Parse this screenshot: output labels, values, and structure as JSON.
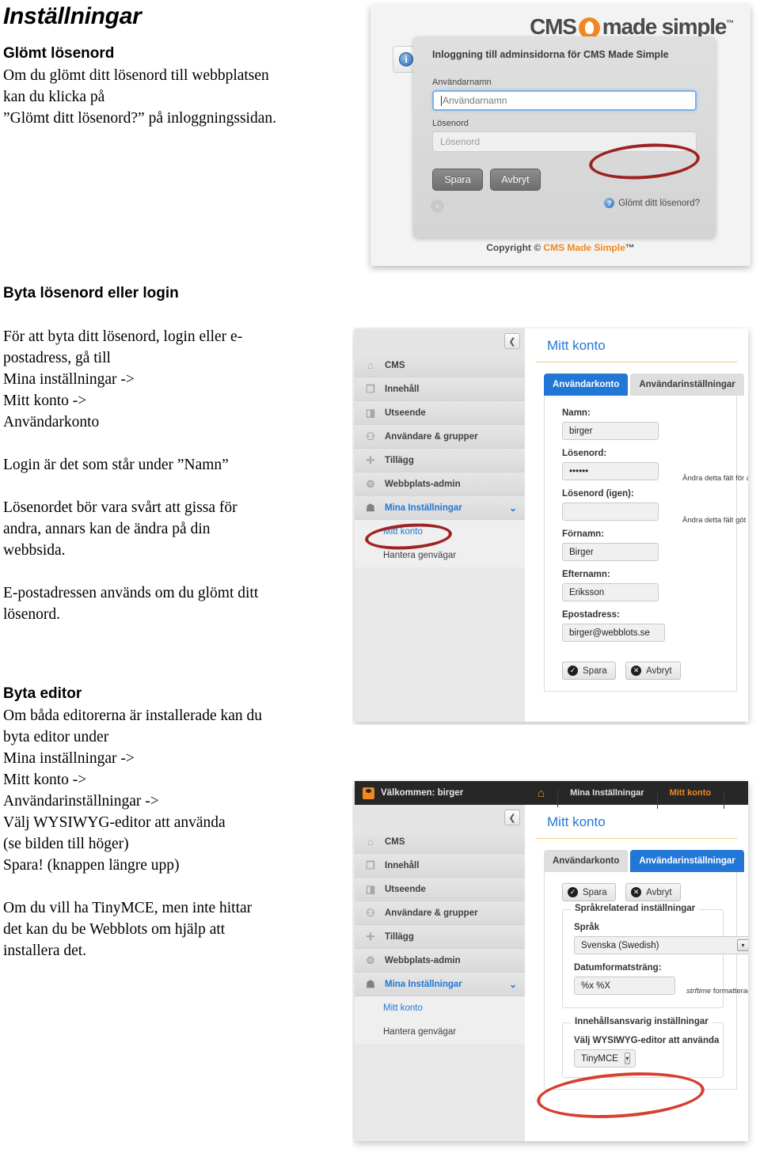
{
  "document": {
    "title": "Inställningar",
    "sections": [
      {
        "heading": "Glömt lösenord",
        "lines": [
          "Om du glömt ditt lösenord till webbplatsen",
          "kan du klicka på",
          "”Glömt ditt lösenord?” på inloggningssidan."
        ]
      },
      {
        "heading": "Byta lösenord eller login",
        "para1": [
          "För att byta ditt lösenord, login eller e-",
          "postadress, gå till",
          "Mina inställningar ->",
          "Mitt konto ->",
          "Användarkonto"
        ],
        "para2": [
          "Login är det som står under ”Namn”"
        ],
        "para3": [
          "Lösenordet bör vara svårt att gissa för",
          "andra, annars kan de ändra på din",
          "webbsida."
        ],
        "para4": [
          "E-postadressen används om du glömt ditt",
          "lösenord."
        ]
      },
      {
        "heading": "Byta editor",
        "para1": [
          "Om båda editorerna är installerade kan du",
          "byta editor under",
          "Mina inställningar ->",
          "Mitt konto ->",
          "Användarinställningar ->",
          "Välj WYSIWYG-editor att använda",
          "(se bilden till höger)",
          "Spara! (knappen längre upp)"
        ],
        "para2": [
          "Om du vill ha TinyMCE, men inte hittar",
          "det kan du be Webblots om hjälp att",
          "installera det."
        ]
      }
    ]
  },
  "screenshot_login": {
    "logo": {
      "part1": "CMS",
      "part2": "made simple",
      "tm": "™"
    },
    "dialog_title": "Inloggning till adminsidorna för CMS Made Simple",
    "username_label": "Användarnamn",
    "username_placeholder": "Användarnamn",
    "password_label": "Lösenord",
    "password_placeholder": "Lösenord",
    "save_button": "Spara",
    "cancel_button": "Avbryt",
    "forgot_link": "Glömt ditt lösenord?",
    "copyright_prefix": "Copyright © ",
    "copyright_brand": "CMS Made Simple",
    "copyright_tm": "™",
    "info_glyph": "i",
    "back_glyph": "‹",
    "question_glyph": "?"
  },
  "screenshot_account": {
    "sidebar": [
      {
        "label": "CMS",
        "icon": "home-icon",
        "glyph": "⌂"
      },
      {
        "label": "Innehåll",
        "icon": "document-icon",
        "glyph": "❐"
      },
      {
        "label": "Utseende",
        "icon": "palette-icon",
        "glyph": "◨"
      },
      {
        "label": "Användare & grupper",
        "icon": "users-icon",
        "glyph": "⚇"
      },
      {
        "label": "Tillägg",
        "icon": "puzzle-icon",
        "glyph": "✛"
      },
      {
        "label": "Webbplats-admin",
        "icon": "gear-icon",
        "glyph": "⚙"
      },
      {
        "label": "Mina Inställningar",
        "icon": "person-icon",
        "glyph": "☗"
      }
    ],
    "sub_items": [
      "Mitt konto",
      "Hantera genvägar"
    ],
    "chevron_glyph": "⌄",
    "collapse_glyph": "❮",
    "page_title": "Mitt konto",
    "tabs": [
      "Användarkonto",
      "Användarinställningar"
    ],
    "selected_tab": "Användarkonto",
    "fields": [
      {
        "label": "Namn:",
        "value": "birger",
        "hint": ""
      },
      {
        "label": "Lösenord:",
        "value": "••••••",
        "hint": "Ändra detta fält för att byta a"
      },
      {
        "label": "Lösenord (igen):",
        "value": "",
        "hint": "Ändra detta fält göt att byta a"
      },
      {
        "label": "Förnamn:",
        "value": "Birger",
        "hint": ""
      },
      {
        "label": "Efternamn:",
        "value": "Eriksson",
        "hint": ""
      },
      {
        "label": "Epostadress:",
        "value": "birger@webblots.se",
        "hint": ""
      }
    ],
    "save_button": "Spara",
    "cancel_button": "Avbryt",
    "save_glyph": "✓",
    "cancel_glyph": "✕"
  },
  "screenshot_settings": {
    "welcome": "Välkommen: birger",
    "sidebar": [
      {
        "label": "CMS",
        "icon": "home-icon",
        "glyph": "⌂"
      },
      {
        "label": "Innehåll",
        "icon": "document-icon",
        "glyph": "❐"
      },
      {
        "label": "Utseende",
        "icon": "palette-icon",
        "glyph": "◨"
      },
      {
        "label": "Användare & grupper",
        "icon": "users-icon",
        "glyph": "⚇"
      },
      {
        "label": "Tillägg",
        "icon": "puzzle-icon",
        "glyph": "✛"
      },
      {
        "label": "Webbplats-admin",
        "icon": "gear-icon",
        "glyph": "⚙"
      },
      {
        "label": "Mina Inställningar",
        "icon": "person-icon",
        "glyph": "☗"
      }
    ],
    "sub_items": [
      "Mitt konto",
      "Hantera genvägar"
    ],
    "chevron_glyph": "⌄",
    "collapse_glyph": "❮",
    "breadcrumbs": [
      "",
      "Mina Inställningar",
      "Mitt konto"
    ],
    "home_glyph": "⌂",
    "page_title": "Mitt konto",
    "tabs": [
      "Användarkonto",
      "Användarinställningar"
    ],
    "selected_tab": "Användarinställningar",
    "save_button": "Spara",
    "cancel_button": "Avbryt",
    "save_glyph": "✓",
    "cancel_glyph": "✕",
    "fieldset1_legend": "Språkrelaterad inställningar",
    "lang_label": "Språk",
    "lang_value": "Svenska (Swedish)",
    "date_label": "Datumformatsträng:",
    "date_value": "%x %X",
    "date_hint_em": "strftime",
    "date_hint_rest": " formatterad d",
    "fieldset2_legend": "Innehållsansvarig inställningar",
    "wysiwyg_label": "Välj WYSIWYG-editor att använda",
    "wysiwyg_value": "TinyMCE",
    "dropdown_glyph": "▾"
  },
  "colors": {
    "accent_blue": "#2277d6",
    "accent_orange": "#f0881f",
    "annotation_dark_red": "#9e2222",
    "annotation_red": "#d6402e"
  }
}
